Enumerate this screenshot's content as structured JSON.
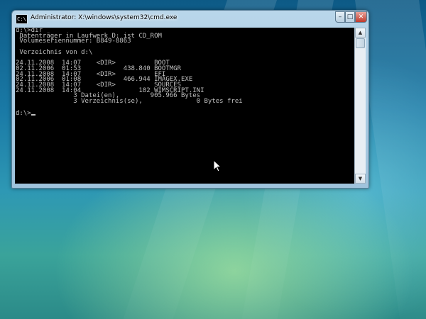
{
  "window": {
    "title": "Administrator: X:\\windows\\system32\\cmd.exe",
    "icon_text": "C:\\",
    "minimize": "–",
    "maximize": "□",
    "close": "✕"
  },
  "console": {
    "lines": [
      "d:\\>dir",
      " Datenträger in Laufwerk D: ist CD_ROM",
      " Volumeseriennummer: B849-8863",
      "",
      " Verzeichnis von d:\\",
      "",
      "24.11.2008  14:07    <DIR>          BOOT",
      "02.11.2006  01:53           438.840 BOOTMGR",
      "24.11.2008  14:07    <DIR>          EFI",
      "02.11.2006  01:08           466.944 IMAGEX.EXE",
      "24.11.2008  14:07    <DIR>          SOURCES",
      "24.11.2008  14:04               182 WIMSCRIPT.INI",
      "               3 Datei(en),        905.966 Bytes",
      "               3 Verzeichnis(se),              0 Bytes frei",
      ""
    ],
    "prompt": "d:\\>"
  },
  "scrollbar": {
    "up": "▲",
    "down": "▼"
  },
  "icons": {
    "app": "cmd-icon",
    "pointer": "mouse-pointer-icon"
  }
}
